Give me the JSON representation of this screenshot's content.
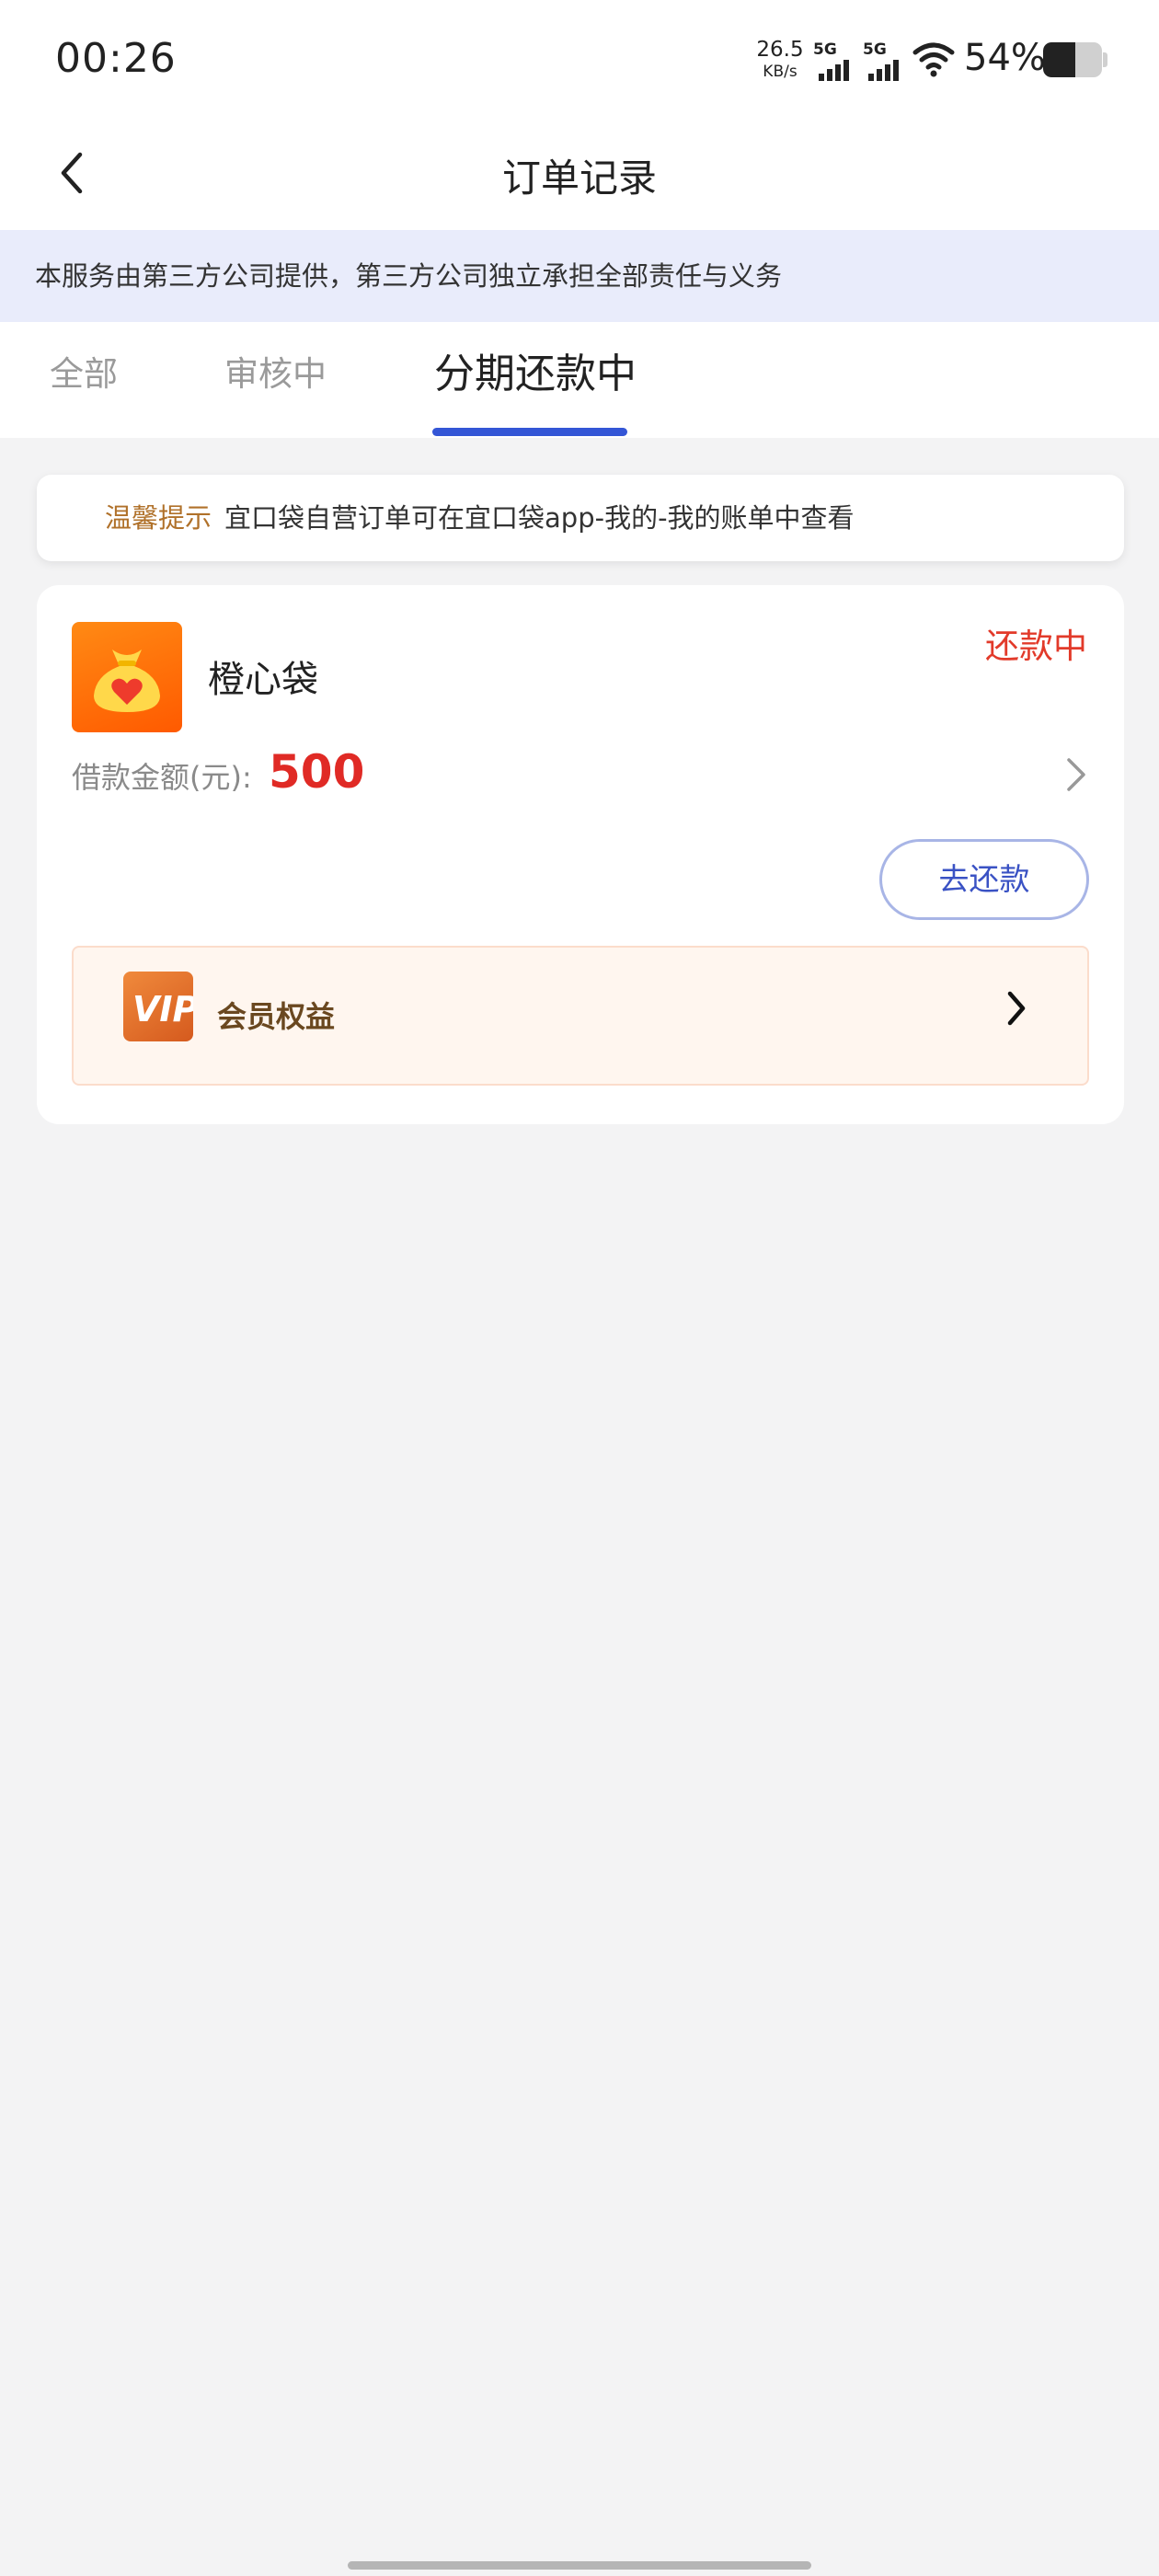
{
  "status_bar": {
    "time": "00:26",
    "net_speed_value": "26.5",
    "net_speed_unit": "KB/s",
    "sim1_label": "5G",
    "sim2_label": "5G",
    "battery_percent": "54%",
    "battery_level": 0.54
  },
  "header": {
    "title": "订单记录",
    "back_icon": "chevron-left-icon"
  },
  "notice": {
    "text": "本服务由第三方公司提供，第三方公司独立承担全部责任与义务"
  },
  "tabs": [
    {
      "label": "全部",
      "active": false
    },
    {
      "label": "审核中",
      "active": false
    },
    {
      "label": "分期还款中",
      "active": true
    }
  ],
  "tip": {
    "label": "温馨提示",
    "text": "宜口袋自营订单可在宜口袋app-我的-我的账单中查看"
  },
  "order": {
    "app_name": "橙心袋",
    "status": "还款中",
    "loan_label": "借款金额(元):",
    "loan_amount": "500",
    "repay_button": "去还款",
    "vip_label": "会员权益",
    "vip_logo_text": "VIP"
  },
  "colors": {
    "accent_blue": "#3456d6",
    "status_red": "#e23a2a",
    "amount_red": "#e02a25",
    "tip_label": "#b0712a",
    "brand_orange": "#ff6a00"
  }
}
